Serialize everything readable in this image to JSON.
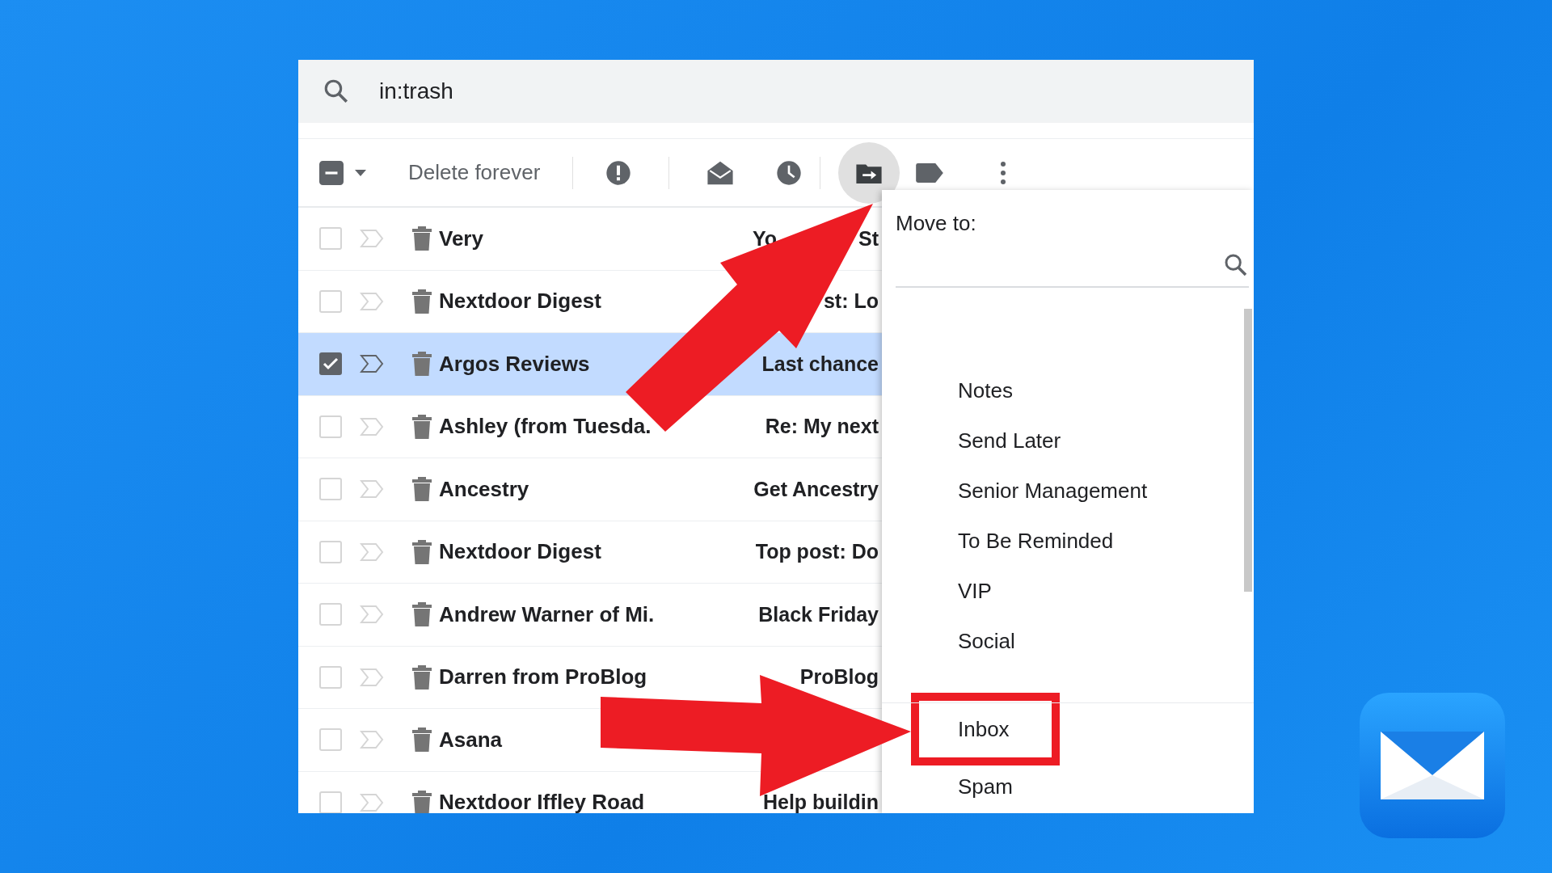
{
  "search": {
    "query": "in:trash"
  },
  "toolbar": {
    "partially_checked": true,
    "delete_label": "Delete forever",
    "move_open": true
  },
  "emails": [
    {
      "sender": "Very",
      "subject": [
        "Yo",
        "St"
      ],
      "selected": false
    },
    {
      "sender": "Nextdoor Digest",
      "subject": [
        "st: Lo"
      ],
      "selected": false
    },
    {
      "sender": "Argos Reviews",
      "subject": [
        "Last chance"
      ],
      "selected": true
    },
    {
      "sender": "Ashley (from Tuesda.",
      "subject": [
        "Re: My next"
      ],
      "selected": false
    },
    {
      "sender": "Ancestry",
      "subject": [
        "Get Ancestry"
      ],
      "selected": false
    },
    {
      "sender": "Nextdoor Digest",
      "subject": [
        "Top post: Do"
      ],
      "selected": false
    },
    {
      "sender": "Andrew Warner of Mi.",
      "subject": [
        "Black Friday"
      ],
      "selected": false
    },
    {
      "sender": "Darren from ProBlog",
      "subject": [
        "ProBlog"
      ],
      "selected": false
    },
    {
      "sender": "Asana",
      "selected": false
    },
    {
      "sender": "Nextdoor Iffley Road",
      "subject": [
        "Help buildin"
      ],
      "selected": false
    }
  ],
  "move_menu": {
    "title": "Move to:",
    "labels": [
      "Notes",
      "Send Later",
      "Senior Management",
      "To Be Reminded",
      "VIP",
      "Social"
    ],
    "system": [
      {
        "label": "Inbox",
        "highlighted": true
      },
      {
        "label": "Spam",
        "highlighted": false
      }
    ]
  }
}
